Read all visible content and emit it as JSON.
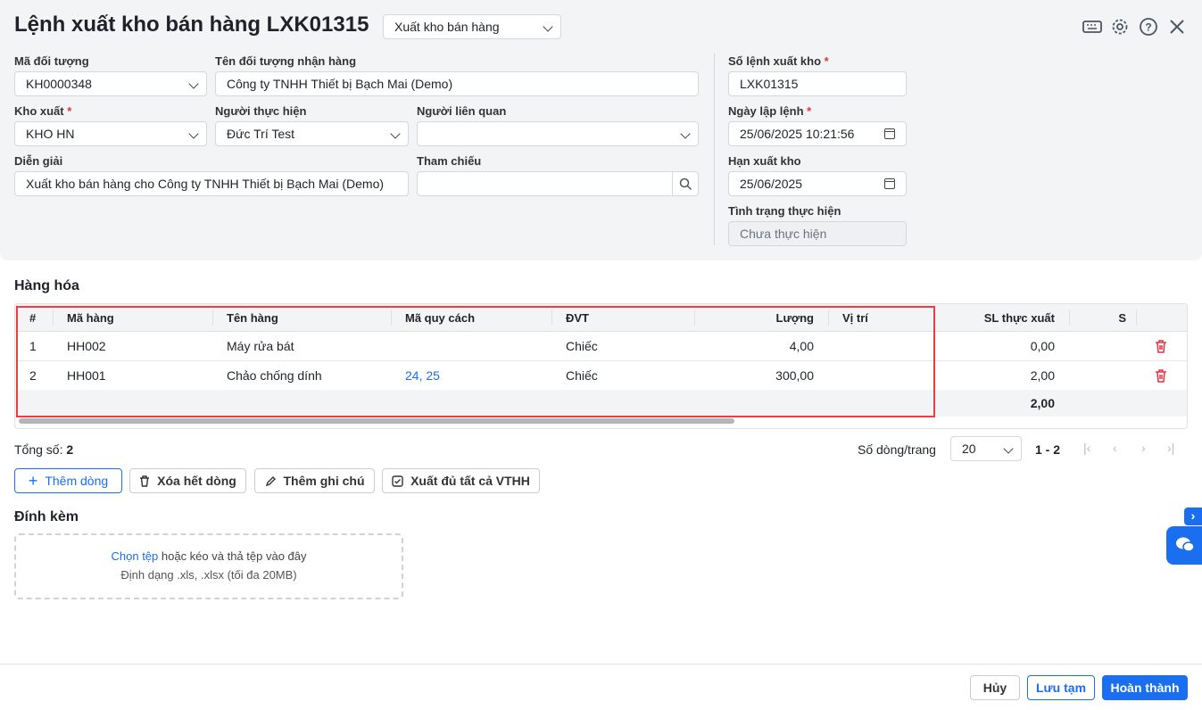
{
  "header": {
    "title": "Lệnh xuất kho bán hàng LXK01315",
    "type_select": "Xuất kho bán hàng"
  },
  "form": {
    "ma_doi_tuong": {
      "label": "Mã đối tượng",
      "value": "KH0000348"
    },
    "ten_doi_tuong": {
      "label": "Tên đối tượng nhận hàng",
      "value": "Công ty TNHH Thiết bị Bạch Mai (Demo)"
    },
    "kho_xuat": {
      "label": "Kho xuất",
      "value": "KHO HN"
    },
    "nguoi_thuc_hien": {
      "label": "Người thực hiện",
      "value": "Đức Trí Test"
    },
    "nguoi_lien_quan": {
      "label": "Người liên quan",
      "value": ""
    },
    "dien_giai": {
      "label": "Diễn giải",
      "value": "Xuất kho bán hàng cho Công ty TNHH Thiết bị Bạch Mai (Demo)"
    },
    "tham_chieu": {
      "label": "Tham chiếu",
      "value": ""
    },
    "so_lenh": {
      "label": "Số lệnh xuất kho",
      "value": "LXK01315"
    },
    "ngay_lap": {
      "label": "Ngày lập lệnh",
      "value": "25/06/2025 10:21:56"
    },
    "han_xuat": {
      "label": "Hạn xuất kho",
      "value": "25/06/2025"
    },
    "tinh_trang": {
      "label": "Tình trạng thực hiện",
      "value": "Chưa thực hiện"
    },
    "required_mark": "*"
  },
  "goods": {
    "title": "Hàng hóa",
    "columns": [
      "#",
      "Mã hàng",
      "Tên hàng",
      "Mã quy cách",
      "ĐVT",
      "Lượng",
      "Vị trí",
      "SL thực xuất",
      "S"
    ],
    "rows": [
      {
        "no": "1",
        "code": "HH002",
        "name": "Máy rửa bát",
        "spec": "",
        "unit": "Chiếc",
        "qty": "4,00",
        "loc": "",
        "actual": "0,00"
      },
      {
        "no": "2",
        "code": "HH001",
        "name": "Chảo chống dính",
        "spec": "24, 25",
        "unit": "Chiếc",
        "qty": "300,00",
        "loc": "",
        "actual": "2,00"
      }
    ],
    "total_actual": "2,00",
    "total_label": "Tổng số:",
    "total_count": "2",
    "page_size_label": "Số dòng/trang",
    "page_size": "20",
    "range": "1 - 2"
  },
  "actions": {
    "add_row": "Thêm dòng",
    "delete_all": "Xóa hết dòng",
    "add_note": "Thêm ghi chú",
    "export_all": "Xuất đủ tất cả VTHH"
  },
  "attach": {
    "title": "Đính kèm",
    "choose": "Chọn tệp",
    "drag": " hoặc kéo và thả tệp vào đây",
    "formats": "Định dạng .xls, .xlsx (tối đa 20MB)"
  },
  "footer": {
    "cancel": "Hủy",
    "save_draft": "Lưu tạm",
    "finish": "Hoàn thành"
  },
  "colors": {
    "accent": "#1a6ef0",
    "highlight": "#ef3b42"
  }
}
